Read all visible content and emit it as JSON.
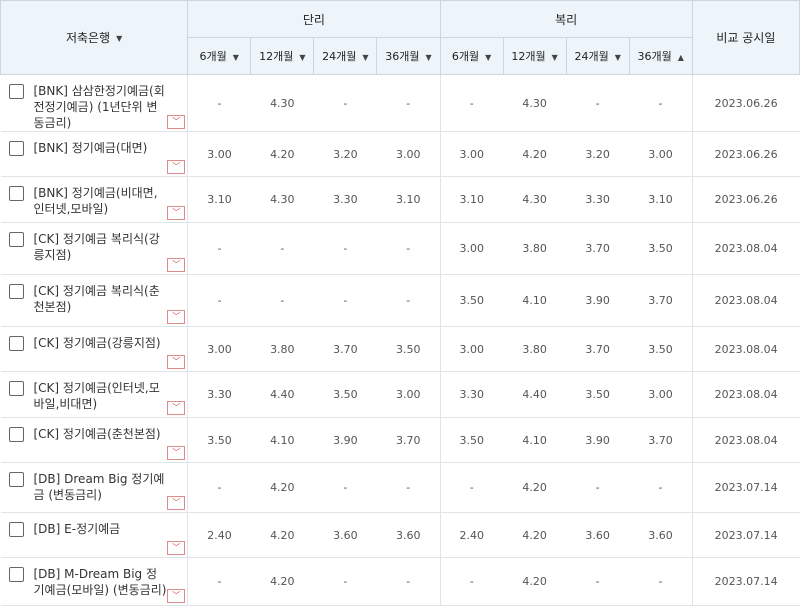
{
  "headers": {
    "bank": "저축은행",
    "simple": "단리",
    "compound": "복리",
    "date": "비교 공시일",
    "periods": [
      "6개월",
      "12개월",
      "24개월",
      "36개월"
    ],
    "sort_down": "▼",
    "sort_up": "▲"
  },
  "expand_icon": "﹀",
  "rows": [
    {
      "name": "[BNK] 삼삼한정기예금(회전정기예금) (1년단위 변동금리)",
      "simple": [
        "-",
        "4.30",
        "-",
        "-"
      ],
      "compound": [
        "-",
        "4.30",
        "-",
        "-"
      ],
      "date": "2023.06.26"
    },
    {
      "name": "[BNK] 정기예금(대면)",
      "simple": [
        "3.00",
        "4.20",
        "3.20",
        "3.00"
      ],
      "compound": [
        "3.00",
        "4.20",
        "3.20",
        "3.00"
      ],
      "date": "2023.06.26"
    },
    {
      "name": "[BNK] 정기예금(비대면,인터넷,모바일)",
      "simple": [
        "3.10",
        "4.30",
        "3.30",
        "3.10"
      ],
      "compound": [
        "3.10",
        "4.30",
        "3.30",
        "3.10"
      ],
      "date": "2023.06.26"
    },
    {
      "name": "[CK] 정기예금 복리식(강릉지점)",
      "simple": [
        "-",
        "-",
        "-",
        "-"
      ],
      "compound": [
        "3.00",
        "3.80",
        "3.70",
        "3.50"
      ],
      "date": "2023.08.04"
    },
    {
      "name": "[CK] 정기예금 복리식(춘천본점)",
      "simple": [
        "-",
        "-",
        "-",
        "-"
      ],
      "compound": [
        "3.50",
        "4.10",
        "3.90",
        "3.70"
      ],
      "date": "2023.08.04"
    },
    {
      "name": "[CK] 정기예금(강릉지점)",
      "simple": [
        "3.00",
        "3.80",
        "3.70",
        "3.50"
      ],
      "compound": [
        "3.00",
        "3.80",
        "3.70",
        "3.50"
      ],
      "date": "2023.08.04"
    },
    {
      "name": "[CK] 정기예금(인터넷,모바일,비대면)",
      "simple": [
        "3.30",
        "4.40",
        "3.50",
        "3.00"
      ],
      "compound": [
        "3.30",
        "4.40",
        "3.50",
        "3.00"
      ],
      "date": "2023.08.04"
    },
    {
      "name": "[CK] 정기예금(춘천본점)",
      "simple": [
        "3.50",
        "4.10",
        "3.90",
        "3.70"
      ],
      "compound": [
        "3.50",
        "4.10",
        "3.90",
        "3.70"
      ],
      "date": "2023.08.04"
    },
    {
      "name": "[DB] Dream Big 정기예금 (변동금리)",
      "simple": [
        "-",
        "4.20",
        "-",
        "-"
      ],
      "compound": [
        "-",
        "4.20",
        "-",
        "-"
      ],
      "date": "2023.07.14"
    },
    {
      "name": "[DB] E-정기예금",
      "simple": [
        "2.40",
        "4.20",
        "3.60",
        "3.60"
      ],
      "compound": [
        "2.40",
        "4.20",
        "3.60",
        "3.60"
      ],
      "date": "2023.07.14"
    },
    {
      "name": "[DB] M-Dream Big 정기예금(모바일) (변동금리)",
      "simple": [
        "-",
        "4.20",
        "-",
        "-"
      ],
      "compound": [
        "-",
        "4.20",
        "-",
        "-"
      ],
      "date": "2023.07.14"
    }
  ]
}
